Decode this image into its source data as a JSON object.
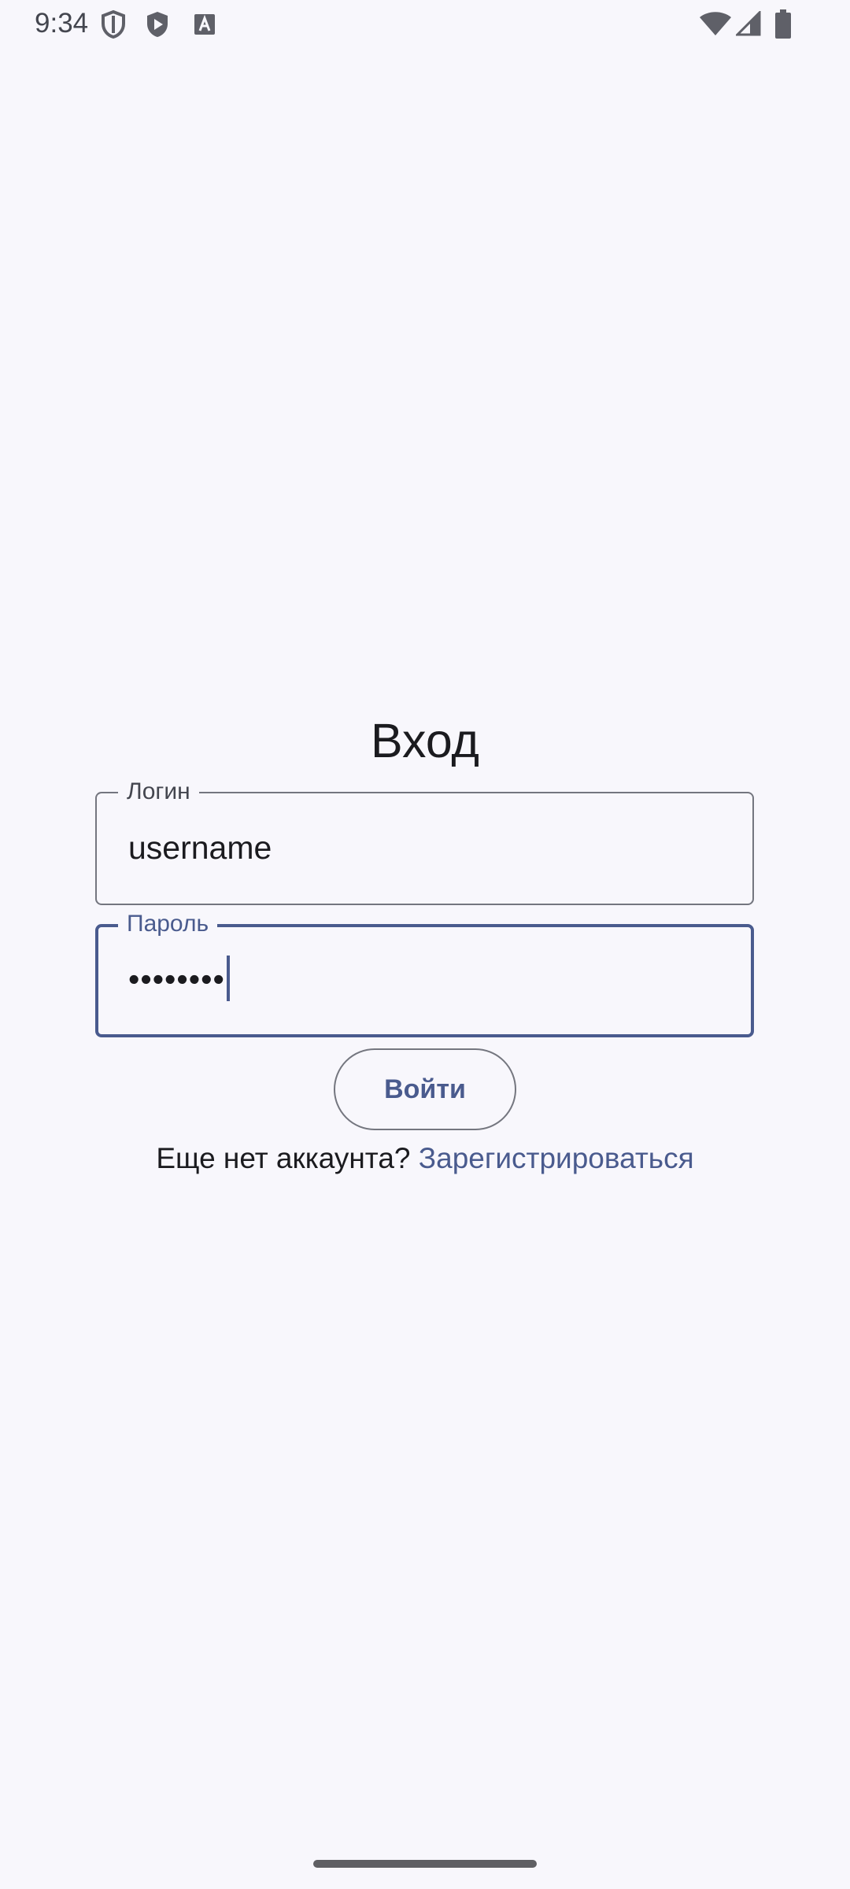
{
  "status_bar": {
    "time": "9:34",
    "left_icons": [
      "shield-outline-icon",
      "shield-play-icon",
      "translate-a-icon"
    ],
    "right_icons": [
      "wifi-icon",
      "signal-icon",
      "battery-icon"
    ]
  },
  "screen": {
    "title": "Вход",
    "login_field": {
      "label": "Логин",
      "value": "username"
    },
    "password_field": {
      "label": "Пароль",
      "value": "••••••••"
    },
    "login_button": {
      "label": "Войти"
    },
    "register": {
      "prompt": "Еще нет аккаунта?",
      "link": "Зарегистрироваться"
    }
  },
  "colors": {
    "background": "#f8f7fc",
    "accent": "#4a5b8e",
    "outline": "#74767f",
    "text": "#1b1b1f"
  }
}
